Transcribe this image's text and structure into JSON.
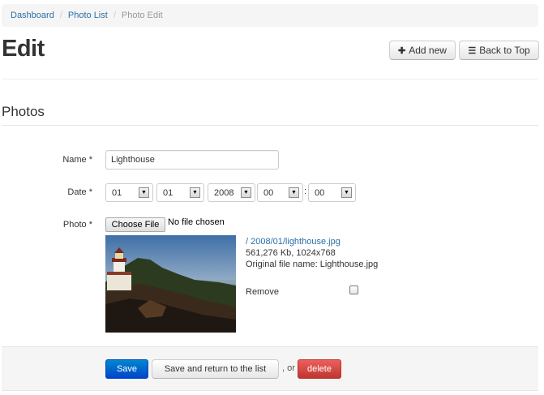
{
  "breadcrumb": {
    "items": [
      {
        "label": "Dashboard"
      },
      {
        "label": "Photo List"
      }
    ],
    "current": "Photo Edit",
    "separator": "/"
  },
  "header": {
    "title": "Edit",
    "add_new_label": "Add new",
    "add_new_icon": "plus-icon",
    "back_to_top_label": "Back to Top",
    "back_to_top_icon": "list-icon"
  },
  "section": {
    "title": "Photos"
  },
  "form": {
    "name": {
      "label": "Name *",
      "value": "Lighthouse"
    },
    "date": {
      "label": "Date *",
      "month": "01",
      "day": "01",
      "year": "2008",
      "hour": "00",
      "minute": "00",
      "separator": ":"
    },
    "photo": {
      "label": "Photo *",
      "choose_file_label": "Choose File",
      "file_status": "No file chosen",
      "current_file_link": "/ 2008/01/lighthouse.jpg",
      "file_info": "561,276 Kb, 1024x768",
      "original_name": "Original file name: Lighthouse.jpg",
      "remove_label": "Remove",
      "remove_checked": false
    }
  },
  "actions": {
    "save_label": "Save",
    "save_return_label": "Save and return to the list",
    "or_text": ", or",
    "delete_label": "delete"
  },
  "colors": {
    "primary": "#0044cc",
    "danger": "#bd362f",
    "link": "#2a6fa8"
  }
}
